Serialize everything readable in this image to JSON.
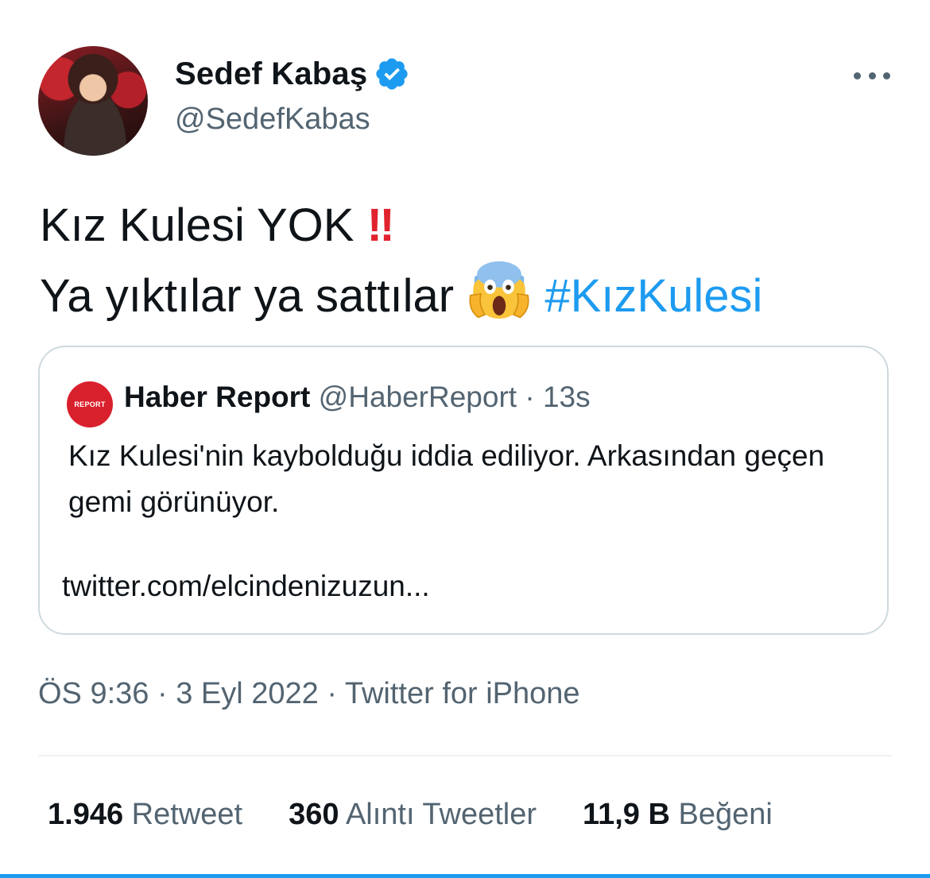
{
  "author": {
    "name": "Sedef Kabaş",
    "handle": "@SedefKabas",
    "verified_color": "#1d9bf0"
  },
  "tweet": {
    "line1": "Kız Kulesi YOK",
    "line1_emoji": "‼",
    "line2": "Ya yıktılar ya sattılar",
    "line2_emoji": "screaming-face-emoji",
    "hashtag": "#KızKulesi"
  },
  "quoted": {
    "avatar_text": "REPORT",
    "name": "Haber Report",
    "handle": "@HaberReport",
    "time": "13s",
    "text": "Kız Kulesi'nin kaybolduğu iddia ediliyor. Arkasından geçen gemi görünüyor.",
    "link": "twitter.com/elcindenizuzun..."
  },
  "meta": {
    "time": "ÖS 9:36",
    "date": "3 Eyl 2022",
    "source": "Twitter for iPhone"
  },
  "stats": {
    "retweets_count": "1.946",
    "retweets_label": "Retweet",
    "quotes_count": "360",
    "quotes_label": "Alıntı Tweetler",
    "likes_count": "11,9 B",
    "likes_label": "Beğeni"
  },
  "colors": {
    "accent": "#1d9bf0",
    "secondary_text": "#536471",
    "alert_red": "#e0232e"
  }
}
